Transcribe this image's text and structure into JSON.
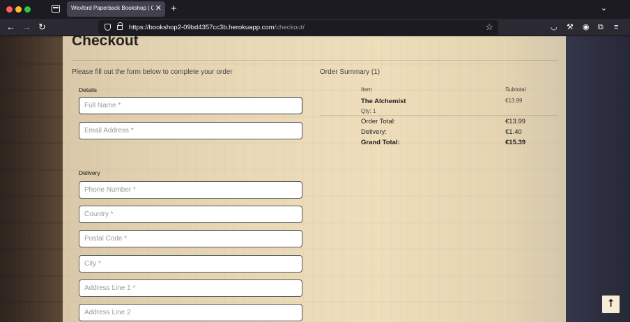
{
  "browser": {
    "tab_title": "Wexford Paperback Bookshop | Qua",
    "tab_close": "✕",
    "new_tab": "+",
    "tabs_dropdown": "⌄",
    "url_host": "https://bookshop2-09bd4357cc3b.herokuapp.com",
    "url_path": "/checkout/",
    "nav": {
      "back": "←",
      "forward": "→",
      "reload": "↻"
    },
    "icons": [
      "shield-icon",
      "lock-icon",
      "star-icon",
      "pocket-icon",
      "wrench-icon",
      "account-icon",
      "extensions-icon",
      "menu-icon"
    ]
  },
  "page": {
    "title": "Checkout",
    "intro": "Please fill out the form below to complete your order",
    "details_label": "Details",
    "delivery_label": "Delivery",
    "fields": {
      "full_name": "Full Name *",
      "email": "Email Address *",
      "phone": "Phone Number *",
      "country": "Country *",
      "postal_code": "Postal Code *",
      "city": "City *",
      "address1": "Address Line 1 *",
      "address2": "Address Line 2"
    }
  },
  "summary": {
    "heading": "Order Summary (1)",
    "col_item": "Item",
    "col_subtotal": "Subtotal",
    "item_title": "The Alchemist",
    "item_qty": "Qty: 1",
    "item_price": "€13.99",
    "order_total_label": "Order Total:",
    "order_total": "€13.99",
    "delivery_label": "Delivery:",
    "delivery": "€1.40",
    "grand_total_label": "Grand Total:",
    "grand_total": "€15.39"
  },
  "back_to_top": "⭡"
}
